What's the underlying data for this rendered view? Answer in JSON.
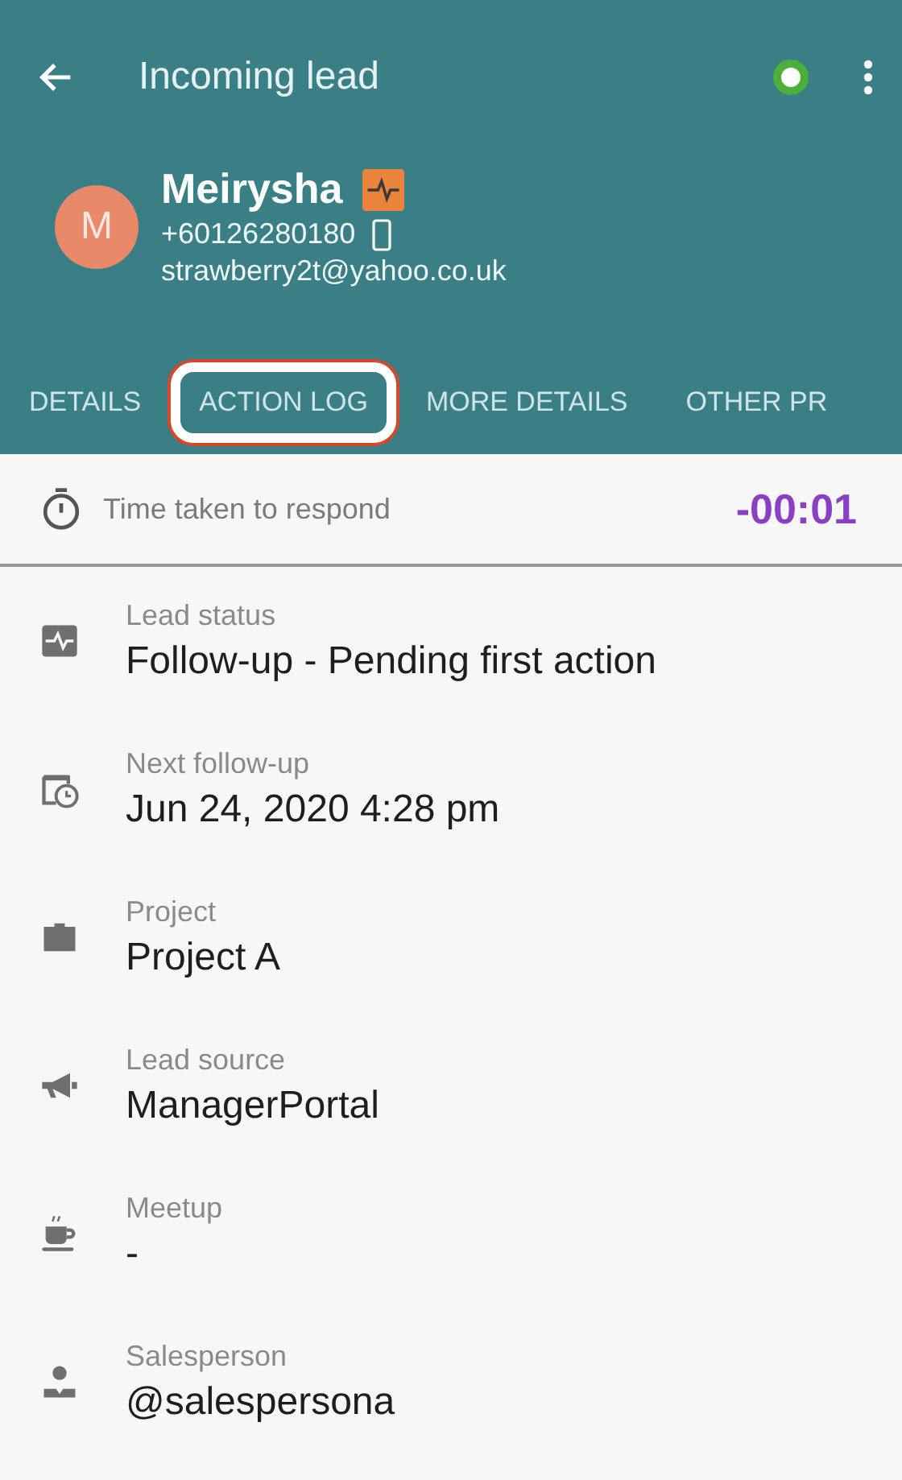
{
  "app_bar": {
    "title": "Incoming lead"
  },
  "lead": {
    "initial": "M",
    "name": "Meirysha",
    "phone": "+60126280180",
    "email": "strawberry2t@yahoo.co.uk"
  },
  "tabs": [
    {
      "label": "DETAILS",
      "highlighted": false
    },
    {
      "label": "ACTION LOG",
      "highlighted": true
    },
    {
      "label": "MORE DETAILS",
      "highlighted": false
    },
    {
      "label": "OTHER PR",
      "highlighted": false
    }
  ],
  "response_time": {
    "label": "Time taken to respond",
    "value": "-00:01"
  },
  "fields": [
    {
      "label": "Lead status",
      "value": "Follow-up - Pending first action"
    },
    {
      "label": "Next follow-up",
      "value": "Jun 24, 2020 4:28 pm"
    },
    {
      "label": "Project",
      "value": "Project A"
    },
    {
      "label": "Lead source",
      "value": "ManagerPortal"
    },
    {
      "label": "Meetup",
      "value": "-"
    },
    {
      "label": "Salesperson",
      "value": "@salespersona"
    }
  ]
}
